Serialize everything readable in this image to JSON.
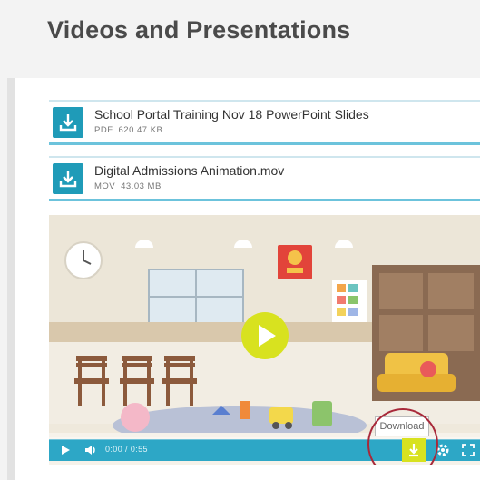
{
  "header": {
    "title": "Videos and Presentations"
  },
  "files": [
    {
      "name": "School Portal Training Nov 18 PowerPoint Slides",
      "type": "PDF",
      "size": "620.47 KB",
      "icon": "download-icon"
    },
    {
      "name": "Digital Admissions Animation.mov",
      "type": "MOV",
      "size": "43.03 MB",
      "icon": "download-icon"
    }
  ],
  "player": {
    "time": "0:00 / 0:55",
    "progress": 0,
    "download_tooltip": "Download",
    "icons": [
      "play-icon",
      "volume-icon",
      "download-icon",
      "settings-icon",
      "fullscreen-icon"
    ],
    "accent_color": "#2da7c6",
    "highlight_color": "#d8e21f"
  }
}
